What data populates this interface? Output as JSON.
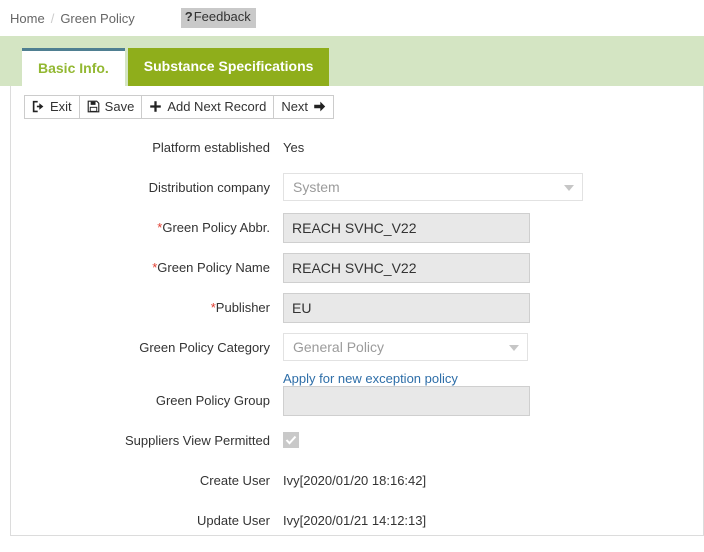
{
  "breadcrumb": {
    "home": "Home",
    "separator": "/",
    "current": "Green Policy",
    "feedback_marker": "?",
    "feedback_label": "Feedback"
  },
  "tabs": [
    {
      "label": "Basic Info.",
      "active": true
    },
    {
      "label": "Substance Specifications",
      "active": false
    }
  ],
  "toolbar": {
    "exit_label": "Exit",
    "save_label": "Save",
    "add_next_record_label": "Add Next Record",
    "next_label": "Next"
  },
  "form": {
    "platform_established": {
      "label": "Platform established",
      "value": "Yes"
    },
    "distribution_company": {
      "label": "Distribution company",
      "value": "System"
    },
    "green_policy_abbr": {
      "label": "Green Policy Abbr.",
      "required_mark": "*",
      "value": "REACH SVHC_V22"
    },
    "green_policy_name": {
      "label": "Green Policy Name",
      "required_mark": "*",
      "value": "REACH SVHC_V22"
    },
    "publisher": {
      "label": "Publisher",
      "required_mark": "*",
      "value": "EU"
    },
    "green_policy_category": {
      "label": "Green Policy Category",
      "value": "General Policy",
      "apply_link": "Apply for new exception policy"
    },
    "green_policy_group": {
      "label": "Green Policy Group",
      "value": ""
    },
    "suppliers_view_permitted": {
      "label": "Suppliers View Permitted",
      "checked": true
    },
    "create_user": {
      "label": "Create User",
      "value": "Ivy[2020/01/20 18:16:42]"
    },
    "update_user": {
      "label": "Update User",
      "value": "Ivy[2020/01/21 14:12:13]"
    }
  },
  "colors": {
    "band_green": "#d4e5c3",
    "tab_active_text": "#93b832",
    "tab_inactive_bg": "#8fae1b",
    "tab_active_top_border": "#4f7f91",
    "required_red": "#e03b2e",
    "link_blue": "#2e6ea8",
    "input_bg": "#e8e8e8"
  }
}
